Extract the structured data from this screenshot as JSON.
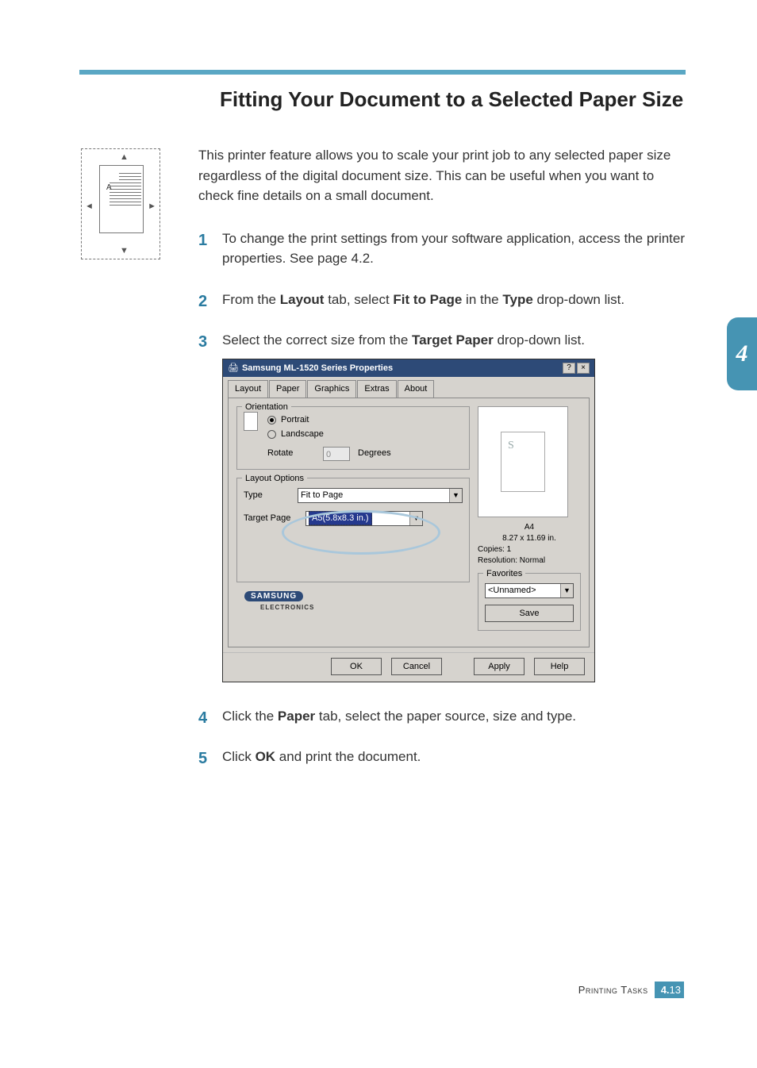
{
  "title": "Fitting Your Document to a Selected Paper Size",
  "illus_letter": "A",
  "intro": "This printer feature allows you to scale your print job to any selected paper size regardless of the digital document size. This can be useful when you want to check fine details on a small document.",
  "steps": {
    "s1": {
      "num": "1",
      "a": "To change the print settings from your software application, access the printer properties. See page 4.2."
    },
    "s2": {
      "num": "2",
      "a": "From the ",
      "b1": "Layout",
      "c": " tab, select ",
      "b2": "Fit to Page",
      "d": " in the ",
      "b3": "Type",
      "e": " drop-down list."
    },
    "s3": {
      "num": "3",
      "a": "Select the correct size from the ",
      "b1": "Target Paper",
      "c": " drop-down list."
    },
    "s4": {
      "num": "4",
      "a": "Click the ",
      "b1": "Paper",
      "c": " tab, select the paper source, size and type."
    },
    "s5": {
      "num": "5",
      "a": "Click ",
      "b1": "OK",
      "c": " and print the document."
    }
  },
  "chapter_number": "4",
  "dialog": {
    "title": "Samsung ML-1520 Series Properties",
    "help_btn": "?",
    "close_btn": "×",
    "tabs": [
      "Layout",
      "Paper",
      "Graphics",
      "Extras",
      "About"
    ],
    "orientation": {
      "label": "Orientation",
      "portrait": "Portrait",
      "landscape": "Landscape",
      "rotate": "Rotate",
      "rotate_value": "0",
      "degrees": "Degrees"
    },
    "layout_options": {
      "label": "Layout Options",
      "type_label": "Type",
      "type_value": "Fit to Page",
      "target_label": "Target Page",
      "target_value": "A5(5.8x8.3 in.)"
    },
    "preview": {
      "letter": "S",
      "size_name": "A4",
      "size_dim": "8.27 x 11.69 in.",
      "copies": "Copies: 1",
      "resolution": "Resolution: Normal"
    },
    "favorites": {
      "label": "Favorites",
      "value": "<Unnamed>",
      "save": "Save"
    },
    "brand": {
      "name": "SAMSUNG",
      "sub": "ELECTRONICS"
    },
    "buttons": {
      "ok": "OK",
      "cancel": "Cancel",
      "apply": "Apply",
      "help": "Help"
    }
  },
  "footer": {
    "label": "Printing Tasks",
    "chapter": "4.",
    "page": "13"
  }
}
